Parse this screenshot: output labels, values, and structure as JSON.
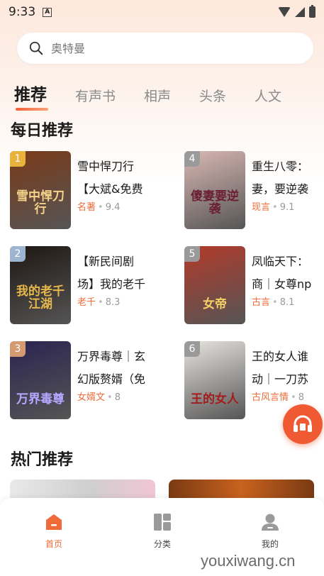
{
  "status_bar": {
    "time": "9:33",
    "notif_letter": "A"
  },
  "search": {
    "placeholder": "奥特曼"
  },
  "tabs": [
    {
      "label": "推荐",
      "active": true
    },
    {
      "label": "有声书"
    },
    {
      "label": "相声"
    },
    {
      "label": "头条"
    },
    {
      "label": "人文"
    }
  ],
  "daily": {
    "title": "每日推荐",
    "books": [
      {
        "rank": "1",
        "line1": "雪中悍刀行",
        "line2": "【大斌&免费",
        "category": "名著",
        "score": "9.4",
        "cover_text": "雪中悍刀行",
        "cover_color": "#7a3a18",
        "rank_color": "#e8b23c",
        "text_color": "#f4d38a"
      },
      {
        "rank": "2",
        "line1": "【新民间剧",
        "line2": "场】我的老千",
        "category": "老千",
        "score": "8.3",
        "cover_text": "我的老千江湖",
        "cover_color": "#1e1712",
        "rank_color": "#9db5d1",
        "text_color": "#e6b74a"
      },
      {
        "rank": "3",
        "line1": "万界毒尊｜玄",
        "line2": "幻版赘婿（免",
        "category": "女婿文",
        "score": "8",
        "cover_text": "万界毒尊",
        "cover_color": "#2a2450",
        "rank_color": "#d49a72",
        "text_color": "#b7a7ff"
      },
      {
        "rank": "4",
        "line1": "重生八零：",
        "line2": "妻，要逆袭",
        "category": "现言",
        "score": "9.1",
        "cover_text": "傻妻要逆袭",
        "cover_color": "#d9b8b4",
        "rank_color": "#9a9a9a",
        "text_color": "#6a1f33"
      },
      {
        "rank": "5",
        "line1": "凤临天下：",
        "line2": "商｜女尊np",
        "category": "古言",
        "score": "8.1",
        "cover_text": "女帝",
        "cover_color": "#b23a2a",
        "rank_color": "#9a9a9a",
        "text_color": "#f5d067"
      },
      {
        "rank": "6",
        "line1": "王的女人谁",
        "line2": "动｜一刀苏",
        "category": "古风言情",
        "score": "8",
        "cover_text": "王的女人",
        "cover_color": "#e8e4e0",
        "rank_color": "#9a9a9a",
        "text_color": "#a21e1e"
      }
    ]
  },
  "hot": {
    "title": "热门推荐"
  },
  "bottom_nav": [
    {
      "label": "首页",
      "icon": "home-icon",
      "active": true
    },
    {
      "label": "分类",
      "icon": "category-icon"
    },
    {
      "label": "我的",
      "icon": "profile-icon"
    }
  ],
  "watermark": "youxiwang.cn",
  "colors": {
    "accent": "#ef6c3a",
    "float_button": "#f05a33"
  }
}
